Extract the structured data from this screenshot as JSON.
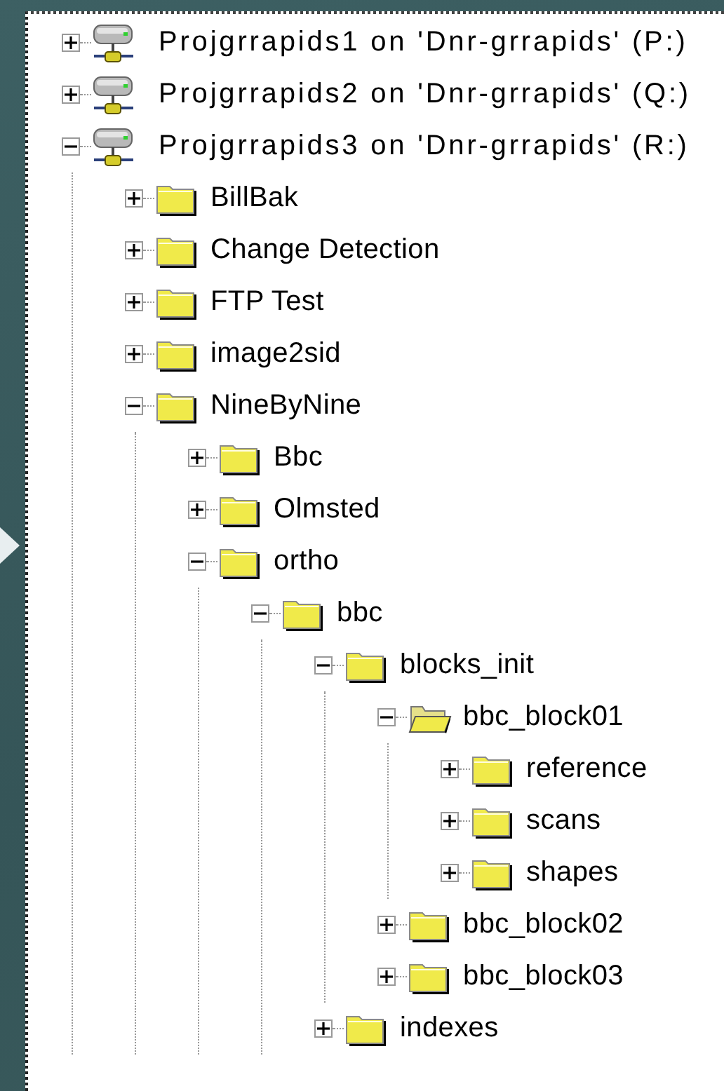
{
  "tree": [
    {
      "kind": "drive",
      "label": "Projgrrapids1 on 'Dnr-grrapids' (P:)",
      "expanded": false,
      "selected": false
    },
    {
      "kind": "drive",
      "label": "Projgrrapids2 on 'Dnr-grrapids' (Q:)",
      "expanded": false,
      "selected": false
    },
    {
      "kind": "drive",
      "label": "Projgrrapids3 on 'Dnr-grrapids' (R:)",
      "expanded": true,
      "selected": false,
      "children": [
        {
          "kind": "folder",
          "label": "BillBak",
          "expanded": false,
          "selected": false
        },
        {
          "kind": "folder",
          "label": "Change Detection",
          "expanded": false,
          "selected": false
        },
        {
          "kind": "folder",
          "label": "FTP Test",
          "expanded": false,
          "selected": false
        },
        {
          "kind": "folder",
          "label": "image2sid",
          "expanded": false,
          "selected": false
        },
        {
          "kind": "folder",
          "label": "NineByNine",
          "expanded": true,
          "selected": false,
          "children": [
            {
              "kind": "folder",
              "label": "Bbc",
              "expanded": false,
              "selected": false
            },
            {
              "kind": "folder",
              "label": "Olmsted",
              "expanded": false,
              "selected": false
            },
            {
              "kind": "folder",
              "label": "ortho",
              "expanded": true,
              "selected": false,
              "children": [
                {
                  "kind": "folder",
                  "label": "bbc",
                  "expanded": true,
                  "selected": false,
                  "children": [
                    {
                      "kind": "folder",
                      "label": "blocks_init",
                      "expanded": true,
                      "selected": false,
                      "children": [
                        {
                          "kind": "folder",
                          "label": "bbc_block01",
                          "expanded": true,
                          "selected": true,
                          "children": [
                            {
                              "kind": "folder",
                              "label": "reference",
                              "expanded": false,
                              "selected": false
                            },
                            {
                              "kind": "folder",
                              "label": "scans",
                              "expanded": false,
                              "selected": false
                            },
                            {
                              "kind": "folder",
                              "label": "shapes",
                              "expanded": false,
                              "selected": false
                            }
                          ]
                        },
                        {
                          "kind": "folder",
                          "label": "bbc_block02",
                          "expanded": false,
                          "selected": false
                        },
                        {
                          "kind": "folder",
                          "label": "bbc_block03",
                          "expanded": false,
                          "selected": false
                        }
                      ]
                    },
                    {
                      "kind": "folder",
                      "label": "indexes",
                      "expanded": false,
                      "selected": false
                    }
                  ]
                }
              ]
            }
          ]
        }
      ]
    }
  ]
}
